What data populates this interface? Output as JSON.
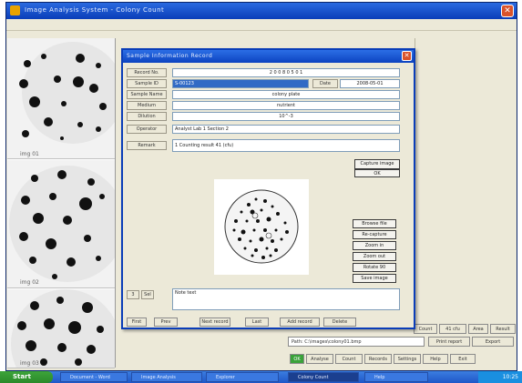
{
  "app": {
    "title": "Image Analysis System - Colony Count",
    "close_glyph": "✕"
  },
  "thumbnails": [
    {
      "label": "img 01"
    },
    {
      "label": "img 02"
    },
    {
      "label": "img 03"
    }
  ],
  "dialog": {
    "title": "Sample Information Record",
    "close_glyph": "✕",
    "fields": [
      {
        "label": "Record No.",
        "value": "2 0 0 8 0 5 0 1"
      },
      {
        "label": "Sample ID",
        "value": "S-00123",
        "extra_label": "Date",
        "extra_value": "2008-05-01"
      },
      {
        "label": "Sample Name",
        "value": "colony plate"
      },
      {
        "label": "Medium",
        "value": "nutrient"
      },
      {
        "label": "Dilution",
        "value": "10^-3"
      },
      {
        "label": "Operator",
        "value": "Analyst  Lab 1  Section 2"
      },
      {
        "label": "Remark",
        "value": "1  Counting result  41  (cfu)"
      }
    ],
    "top_button_label": "Capture image",
    "top_button_sub": "OK",
    "side_buttons": [
      "Browse file",
      "Re-capture",
      "Zoom in",
      "Zoom out",
      "Rotate 90",
      "Save image"
    ],
    "bottom_note_label": "3",
    "bottom_note_sub": "Sel",
    "bottom_note_value": "Note text",
    "bottom_tabs": [
      "First",
      "Prev",
      "Next record",
      "Last",
      "Add record",
      "Delete"
    ]
  },
  "status": {
    "row1": [
      "Count",
      "41 cfu",
      "Area",
      "Result"
    ],
    "row2": [
      "Path: C:\\images\\colony01.bmp",
      "Print report",
      "Export"
    ],
    "row3": [
      "OK",
      "Analyse",
      "Count",
      "Records",
      "Settings",
      "Help",
      "Exit"
    ]
  },
  "taskbar": {
    "start_label": "Start",
    "tasks": [
      "Document - Word",
      "Image Analysis",
      "Explorer",
      "Colony Count",
      "Help"
    ],
    "clock": "10:25"
  },
  "colors": {
    "titlebar": "#0a3db8",
    "face": "#ece9d8",
    "taskbar": "#245edb",
    "start": "#3a9a36"
  }
}
